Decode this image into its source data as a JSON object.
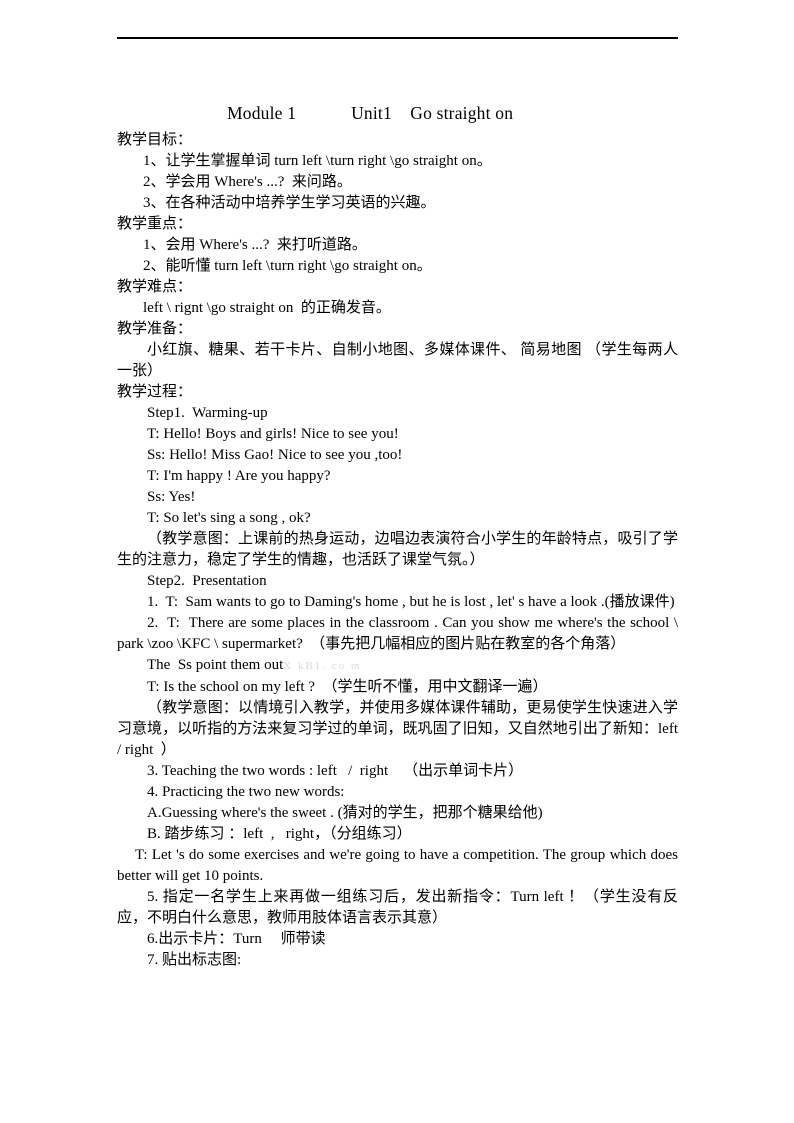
{
  "document": {
    "title_line": "Module 1            Unit1    Go straight on",
    "watermark": "X kB1. co m",
    "sections": [
      {
        "heading": "教学目标：",
        "items": [
          "1、让学生掌握单词 turn left \\turn right \\go straight on。",
          "2、学会用 Where's ...?  来问路。",
          "3、在各种活动中培养学生学习英语的兴趣。"
        ]
      },
      {
        "heading": "教学重点：",
        "items": [
          "1、会用 Where's ...?  来打听道路。",
          "2、能听懂 turn left \\turn right \\go straight on。"
        ]
      },
      {
        "heading": "教学难点：",
        "items": [
          "left \\ rignt \\go straight on  的正确发音。"
        ]
      },
      {
        "heading": "教学准备：",
        "items": [
          "小红旗、糖果、若干卡片、自制小地图、多媒体课件、 简易地图 （学生每两人一张）"
        ]
      },
      {
        "heading": "教学过程：",
        "items": []
      }
    ],
    "step1": {
      "label": "Step1.  Warming-up",
      "lines": [
        "T: Hello! Boys and girls! Nice to see you!",
        "Ss: Hello! Miss Gao! Nice to see you ,too!",
        "T: I'm happy ! Are you happy?",
        "Ss: Yes!",
        "T: So let's sing a song , ok?"
      ],
      "note": "（教学意图：上课前的热身运动，边唱边表演符合小学生的年龄特点，吸引了学生的注意力，稳定了学生的情趣，也活跃了课堂气氛。）"
    },
    "step2": {
      "label": "Step2.  Presentation",
      "item1": "1.  T:  Sam wants to go to Daming's home , but he is lost , let' s have a look .(播放课件)",
      "item2": "2.  T:  There are some places in the classroom . Can you show me where's the school \\ park \\zoo \\KFC \\ supermarket?  （事先把几幅相应的图片贴在教室的各个角落）",
      "point_line": "The  Ss point them out",
      "ask_line": "T: Is the school on my left ?  （学生听不懂，用中文翻译一遍）",
      "note2": "（教学意图：以情境引入教学，并使用多媒体课件辅助，更易使学生快速进入学习意境，以听指的方法来复习学过的单词，既巩固了旧知，又自然地引出了新知：left / right  ）",
      "item3": "3. Teaching the two words : left   /  right    （出示单词卡片）",
      "item4": "4. Practicing the two new words:",
      "item4a": "A.Guessing where's the sweet . (猜对的学生，把那个糖果给他)",
      "item4b": "B. 踏步练习 ：left  ,   right，（分组练习）",
      "competition": "T: Let 's do some exercises and we're going to have a competition. The group which does better will get 10 points.",
      "item5": "5. 指定一名学生上来再做一组练习后，发出新指令：Turn left ！（学生没有反应，不明白什么意思，教师用肢体语言表示其意）",
      "item6": "6.出示卡片：Turn     师带读",
      "item7": "7. 贴出标志图:"
    }
  }
}
